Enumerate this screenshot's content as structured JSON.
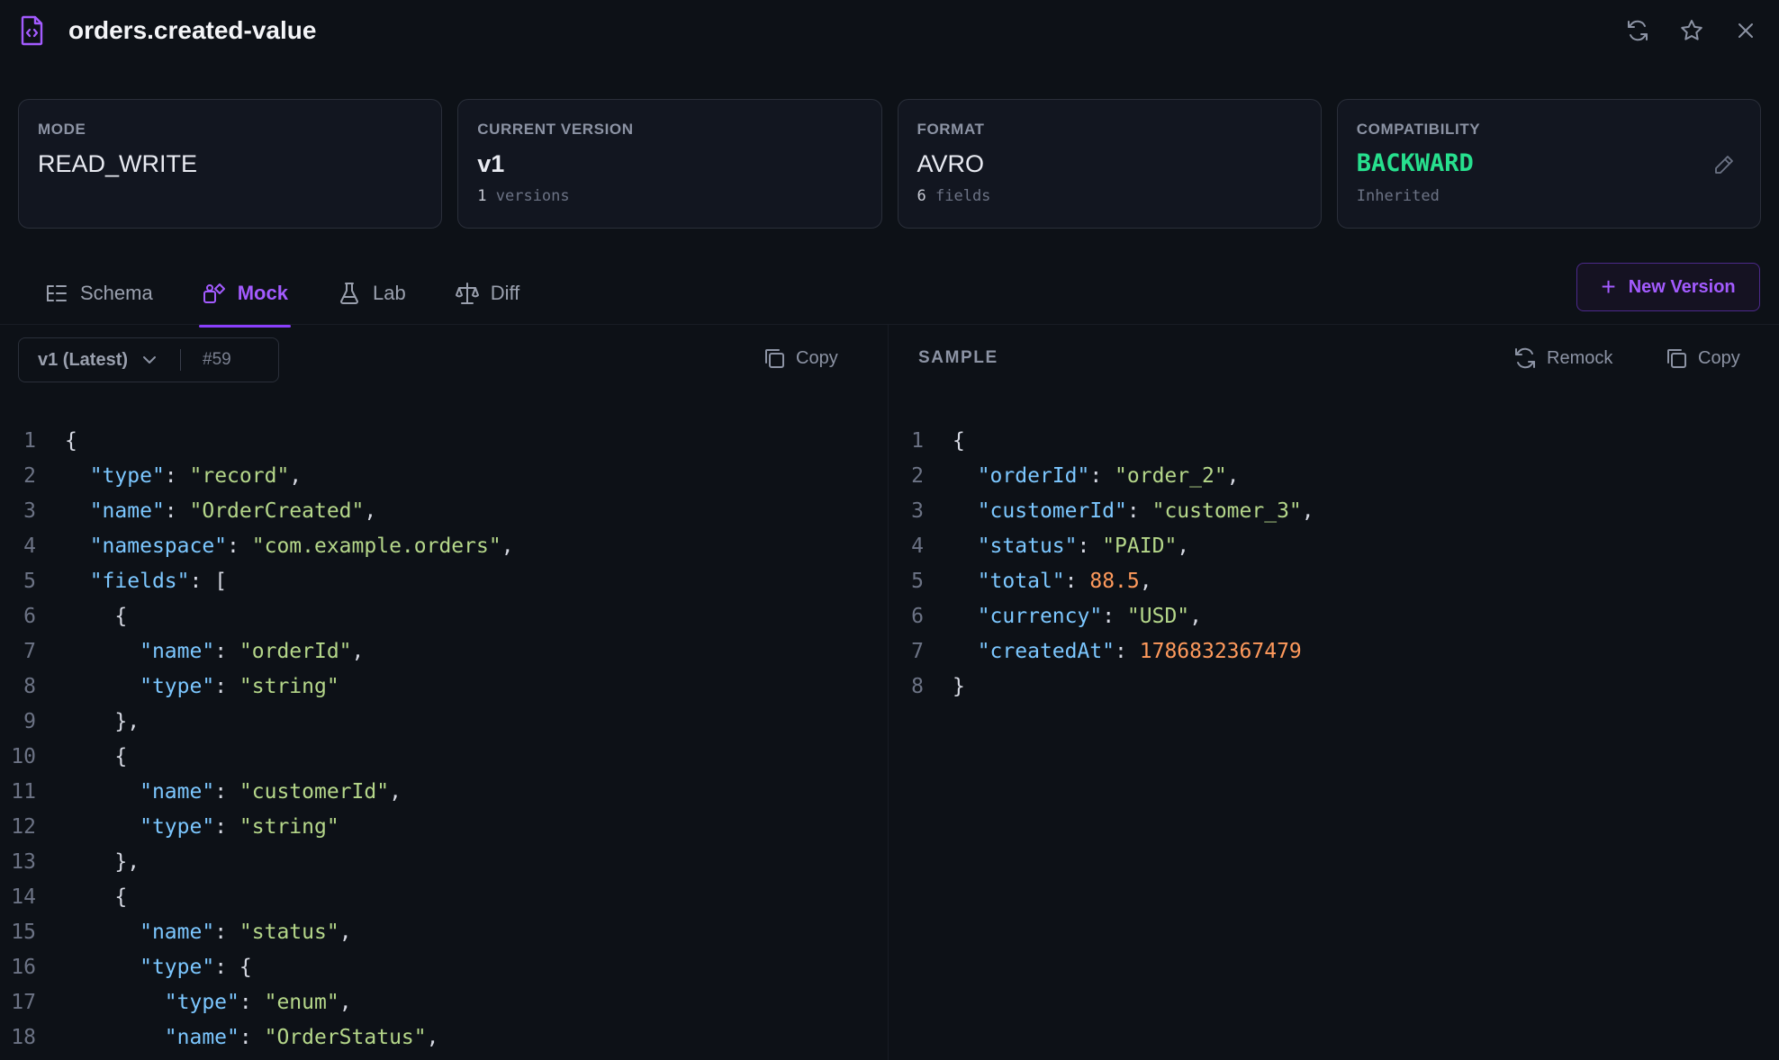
{
  "header": {
    "title": "orders.created-value",
    "icons": [
      "file-code-icon",
      "refresh-icon",
      "star-icon",
      "close-icon"
    ]
  },
  "cards": {
    "mode": {
      "label": "MODE",
      "value": "READ_WRITE"
    },
    "current_version": {
      "label": "CURRENT VERSION",
      "value": "v1",
      "sub_count": "1",
      "sub_text": "versions"
    },
    "format": {
      "label": "FORMAT",
      "value": "AVRO",
      "sub_count": "6",
      "sub_text": "fields"
    },
    "compatibility": {
      "label": "COMPATIBILITY",
      "value": "BACKWARD",
      "sub_text": "Inherited",
      "value_color": "#27e08e"
    }
  },
  "tabs": [
    {
      "label": "Schema",
      "icon": "list-tree-icon"
    },
    {
      "label": "Mock",
      "icon": "mock-shapes-icon",
      "active": true
    },
    {
      "label": "Lab",
      "icon": "flask-icon"
    },
    {
      "label": "Diff",
      "icon": "scale-icon"
    }
  ],
  "new_version_label": "New Version",
  "left_toolbar": {
    "version": "v1 (Latest)",
    "schema_id": "#59",
    "copy_label": "Copy"
  },
  "right_toolbar": {
    "sample_label": "SAMPLE",
    "remock_label": "Remock",
    "copy_label": "Copy"
  },
  "schema_lines": [
    "{",
    "  \"type\": \"record\",",
    "  \"name\": \"OrderCreated\",",
    "  \"namespace\": \"com.example.orders\",",
    "  \"fields\": [",
    "    {",
    "      \"name\": \"orderId\",",
    "      \"type\": \"string\"",
    "    },",
    "    {",
    "      \"name\": \"customerId\",",
    "      \"type\": \"string\"",
    "    },",
    "    {",
    "      \"name\": \"status\",",
    "      \"type\": {",
    "        \"type\": \"enum\",",
    "        \"name\": \"OrderStatus\","
  ],
  "sample_lines": [
    "{",
    "  \"orderId\": \"order_2\",",
    "  \"customerId\": \"customer_3\",",
    "  \"status\": \"PAID\",",
    "  \"total\": 88.5,",
    "  \"currency\": \"USD\",",
    "  \"createdAt\": 1786832367479",
    "}"
  ],
  "colors": {
    "accent": "#8a3ffc",
    "key": "#7cc7ff",
    "string": "#b5d78a",
    "number": "#ff9a5c",
    "background": "#0d1117"
  }
}
